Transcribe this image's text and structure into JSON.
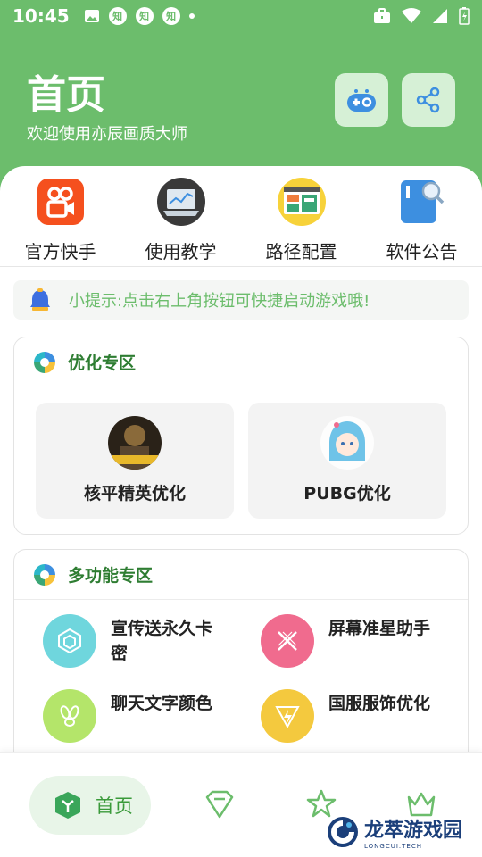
{
  "status_bar": {
    "time": "10:45",
    "badges": [
      "知",
      "知",
      "知"
    ]
  },
  "header": {
    "title": "首页",
    "subtitle": "欢迎使用亦辰画质大师"
  },
  "quick_menu": [
    {
      "label": "官方快手",
      "icon": "kuaishou-icon"
    },
    {
      "label": "使用教学",
      "icon": "laptop-chart-icon"
    },
    {
      "label": "路径配置",
      "icon": "dashboard-icon"
    },
    {
      "label": "软件公告",
      "icon": "notice-search-icon"
    }
  ],
  "tip": {
    "text": "小提示:点击右上角按钮可快捷启动游戏哦!"
  },
  "optimize_section": {
    "title": "优化专区",
    "items": [
      {
        "label": "核平精英优化"
      },
      {
        "label": "PUBG优化"
      }
    ]
  },
  "multi_section": {
    "title": "多功能专区",
    "items": [
      {
        "label": "宣传送永久卡密",
        "color": "#6fd6dd"
      },
      {
        "label": "屏幕准星助手",
        "color": "#f06b8e"
      },
      {
        "label": "聊天文字颜色",
        "color": "#b4e56a"
      },
      {
        "label": "国服服饰优化",
        "color": "#f4c93e"
      }
    ]
  },
  "bottom_nav": {
    "home_label": "首页"
  },
  "watermark": {
    "title": "龙萃游戏园",
    "subtitle": "LONGCUI.TECH"
  },
  "colors": {
    "accent": "#6cbd6c",
    "dark_green": "#2e7d32"
  }
}
